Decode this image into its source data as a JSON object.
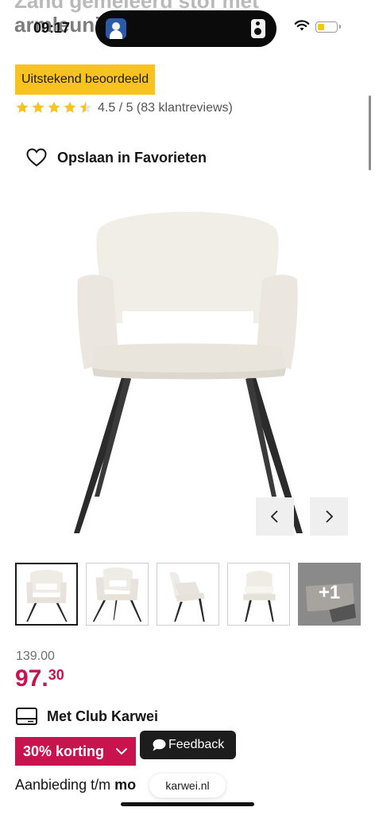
{
  "page": {
    "title_line1": "Zand gemeleerd stof met",
    "title_line2": "armleuning"
  },
  "status_bar": {
    "time": "09:17"
  },
  "rating": {
    "badge": "Uitstekend beoordeeld",
    "stars": 4.5,
    "text": "4.5 / 5 (83 klantreviews)",
    "star_color": "#f9c31f"
  },
  "favorites": {
    "label": "Opslaan in Favorieten"
  },
  "gallery": {
    "prev_icon": "chevron-left-icon",
    "next_icon": "chevron-right-icon",
    "more_count": "+1"
  },
  "pricing": {
    "old_price": "139.00",
    "price_int": "97.",
    "price_cents": "30",
    "price_color": "#c8134f"
  },
  "club": {
    "label": "Met Club Karwei"
  },
  "discount": {
    "label": "30% korting"
  },
  "feedback": {
    "label": "Feedback"
  },
  "offer": {
    "prefix": "Aanbieding t/m ",
    "date_partial": "mo"
  },
  "browser": {
    "url": "karwei.nl"
  }
}
